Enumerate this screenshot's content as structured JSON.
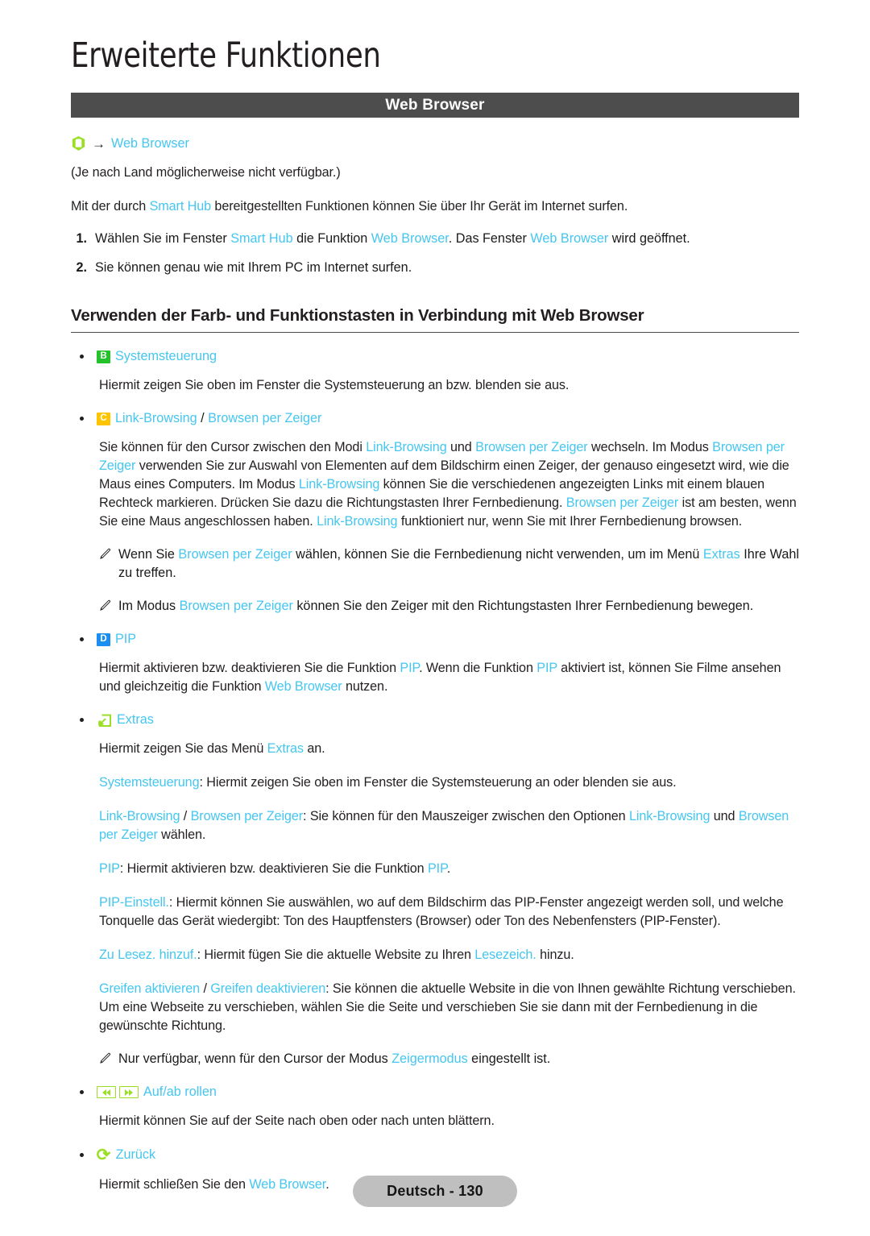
{
  "chapter": {
    "title": "Erweiterte Funktionen"
  },
  "section": {
    "title": "Web Browser"
  },
  "menu_path": {
    "icon": "smart-hub-icon",
    "arrow": "→",
    "target": "Web Browser"
  },
  "availability_note": "(Je nach Land möglicherweise nicht verfügbar.)",
  "intro": {
    "part1": "Mit der durch ",
    "link1": "Smart Hub",
    "part2": " bereitgestellten Funktionen können Sie über Ihr Gerät im Internet surfen."
  },
  "steps": [
    {
      "num": "1.",
      "part1": "Wählen Sie im Fenster ",
      "link1": "Smart Hub",
      "part2": " die Funktion ",
      "link2": "Web Browser",
      "part3": ". Das Fenster ",
      "link3": "Web Browser",
      "part4": " wird geöffnet."
    },
    {
      "num": "2.",
      "part1": "Sie können genau wie mit Ihrem PC im Internet surfen."
    }
  ],
  "subsection": {
    "heading": "Verwenden der Farb- und Funktionstasten in Verbindung mit Web Browser"
  },
  "items": {
    "systemsteuerung": {
      "key": "B",
      "label": "Systemsteuerung",
      "desc": "Hiermit zeigen Sie oben im Fenster die Systemsteuerung an bzw. blenden sie aus."
    },
    "link_browsing": {
      "key": "C",
      "label_a": "Link-Browsing",
      "separator": " / ",
      "label_b": "Browsen per Zeiger",
      "desc": {
        "t1": "Sie können für den Cursor zwischen den Modi ",
        "l1": "Link-Browsing",
        "t2": " und ",
        "l2": "Browsen per Zeiger",
        "t3": " wechseln. Im Modus ",
        "l3": "Browsen per Zeiger",
        "t4": " verwenden Sie zur Auswahl von Elementen auf dem Bildschirm einen Zeiger, der genauso eingesetzt wird, wie die Maus eines Computers. Im Modus ",
        "l4": "Link-Browsing",
        "t5": " können Sie die verschiedenen angezeigten Links mit einem blauen Rechteck markieren. Drücken Sie dazu die Richtungstasten Ihrer Fernbedienung. ",
        "l5": "Browsen per Zeiger",
        "t6": " ist am besten, wenn Sie eine Maus angeschlossen haben. ",
        "l6": "Link-Browsing",
        "t7": " funktioniert nur, wenn Sie mit Ihrer Fernbedienung browsen."
      },
      "notes": [
        {
          "t1": "Wenn Sie ",
          "l1": "Browsen per Zeiger",
          "t2": " wählen, können Sie die Fernbedienung nicht verwenden, um im Menü ",
          "l2": "Extras",
          "t3": " Ihre Wahl zu treffen."
        },
        {
          "t1": "Im Modus ",
          "l1": "Browsen per Zeiger",
          "t2": " können Sie den Zeiger mit den Richtungstasten Ihrer Fernbedienung bewegen.",
          "l2": "",
          "t3": ""
        }
      ]
    },
    "pip": {
      "key": "D",
      "label": "PIP",
      "desc": {
        "t1": "Hiermit aktivieren bzw. deaktivieren Sie die Funktion ",
        "l1": "PIP",
        "t2": ". Wenn die Funktion ",
        "l2": "PIP",
        "t3": " aktiviert ist, können Sie Filme ansehen und gleichzeitig die Funktion ",
        "l3": "Web Browser",
        "t4": " nutzen."
      }
    },
    "extras": {
      "icon": "tools-icon",
      "label": "Extras",
      "desc": {
        "t1": "Hiermit zeigen Sie das Menü ",
        "l1": "Extras",
        "t2": " an."
      },
      "sub_entries": [
        {
          "l1": "Systemsteuerung",
          "t1": ": Hiermit zeigen Sie oben im Fenster die Systemsteuerung an oder blenden sie aus.",
          "l2": "",
          "t2": "",
          "l3": "",
          "t3": "",
          "l4": "",
          "t4": ""
        },
        {
          "l1": "Link-Browsing",
          "t1": " / ",
          "l2": "Browsen per Zeiger",
          "t2": ": Sie können für den Mauszeiger zwischen den Optionen ",
          "l3": "Link-Browsing",
          "t3": " und ",
          "l4": "Browsen per Zeiger",
          "t4": " wählen."
        },
        {
          "l1": "PIP",
          "t1": ": Hiermit aktivieren bzw. deaktivieren Sie die Funktion ",
          "l2": "PIP",
          "t2": ".",
          "l3": "",
          "t3": "",
          "l4": "",
          "t4": ""
        },
        {
          "l1": "PIP-Einstell.",
          "t1": ": Hiermit können Sie auswählen, wo auf dem Bildschirm das PIP-Fenster angezeigt werden soll, und welche Tonquelle das Gerät wiedergibt: Ton des Hauptfensters (Browser) oder Ton des Nebenfensters (PIP-Fenster).",
          "l2": "",
          "t2": "",
          "l3": "",
          "t3": "",
          "l4": "",
          "t4": ""
        },
        {
          "l1": "Zu Lesez. hinzuf.",
          "t1": ": Hiermit fügen Sie die aktuelle Website zu Ihren ",
          "l2": "Lesezeich.",
          "t2": " hinzu.",
          "l3": "",
          "t3": "",
          "l4": "",
          "t4": ""
        },
        {
          "l1": "Greifen aktivieren",
          "t1": " / ",
          "l2": "Greifen deaktivieren",
          "t2": ": Sie können die aktuelle Website in die von Ihnen gewählte Richtung verschieben. Um eine Webseite zu verschieben, wählen Sie die Seite und verschieben Sie sie dann mit der Fernbedienung in die gewünschte Richtung.",
          "l3": "",
          "t3": "",
          "l4": "",
          "t4": ""
        }
      ],
      "grab_note": {
        "t1": "Nur verfügbar, wenn für den Cursor der Modus ",
        "l1": "Zeigermodus",
        "t2": " eingestellt ist."
      }
    },
    "scroll": {
      "icon_rewind": "rewind-icon",
      "icon_forward": "fast-forward-icon",
      "label": "Auf/ab rollen",
      "desc": "Hiermit können Sie auf der Seite nach oben oder nach unten blättern."
    },
    "back": {
      "icon": "return-icon",
      "label": "Zurück",
      "desc": {
        "t1": "Hiermit schließen Sie den ",
        "l1": "Web Browser",
        "t2": "."
      }
    }
  },
  "footer": {
    "label": "Deutsch - 130"
  },
  "colors": {
    "accent_cyan": "#45c6f0",
    "key_green": "#22c32a",
    "key_yellow": "#ffc400",
    "key_blue": "#1b8ef2",
    "icon_green": "#9ade26",
    "bar_gray": "#4d4d4d",
    "footer_gray": "#bfbfbf"
  }
}
